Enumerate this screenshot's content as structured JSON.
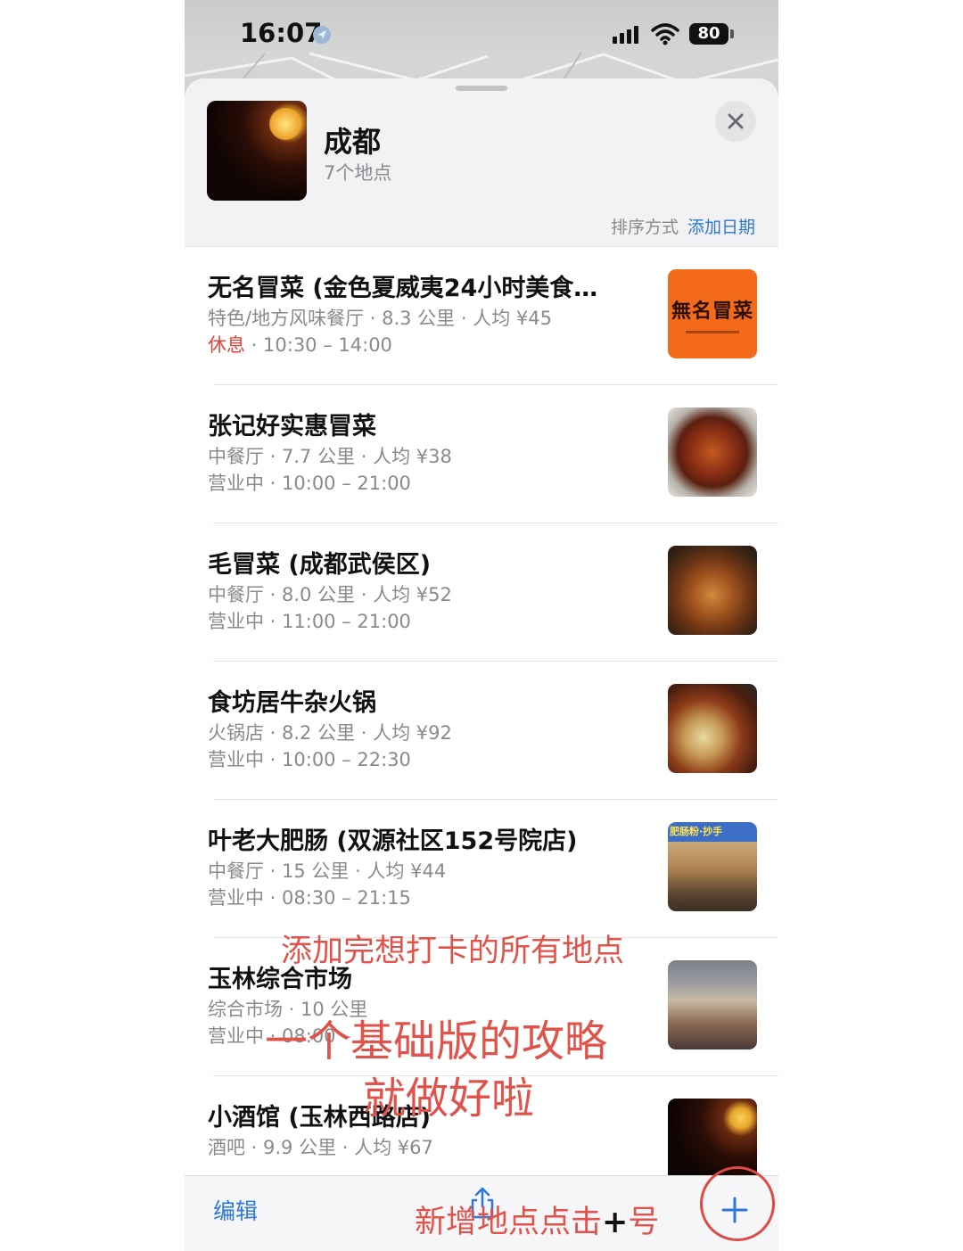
{
  "status_bar": {
    "time": "16:07",
    "battery": "80"
  },
  "header": {
    "title": "成都",
    "subtitle": "7个地点",
    "sort_label": "排序方式",
    "sort_value": "添加日期"
  },
  "places": [
    {
      "name": "无名冒菜 (金色夏威夷24小时美食…",
      "meta": "特色/地方风味餐厅 · 8.3 公里 · 人均 ¥45",
      "status": "休息",
      "hours": " · 10:30 – 14:00",
      "thumb_text": "無名冒菜"
    },
    {
      "name": "张记好实惠冒菜",
      "meta": "中餐厅 · 7.7 公里 · 人均 ¥38",
      "status": "营业中",
      "hours": " · 10:00 – 21:00"
    },
    {
      "name": "毛冒菜 (成都武侯区)",
      "meta": "中餐厅 · 8.0 公里 · 人均 ¥52",
      "status": "营业中",
      "hours": " · 11:00 – 21:00"
    },
    {
      "name": "食坊居牛杂火锅",
      "meta": "火锅店 · 8.2 公里 · 人均 ¥92",
      "status": "营业中",
      "hours": " · 10:00 – 22:30"
    },
    {
      "name": "叶老大肥肠 (双源社区152号院店)",
      "meta": "中餐厅 · 15 公里 · 人均 ¥44",
      "status": "营业中",
      "hours": " · 08:30 – 21:15",
      "thumb_text": "肥肠粉·抄手"
    },
    {
      "name": "玉林综合市场",
      "meta": "综合市场 · 10 公里",
      "status": "营业中",
      "hours": " · 08:00 – …"
    },
    {
      "name": "小酒馆 (玉林西路店)",
      "meta": "酒吧 · 9.9 公里 · 人均 ¥67",
      "status": "",
      "hours": ""
    }
  ],
  "annotations": {
    "line1": "添加完想打卡的所有地点",
    "line2": "一个基础版的攻略",
    "line3": "就做好啦",
    "line4_a": "新增地点点击",
    "line4_plus": "+",
    "line4_b": "号"
  },
  "toolbar": {
    "edit_label": "编辑"
  },
  "colors": {
    "accent": "#2b78d6",
    "closed": "#e0453a",
    "annotation": "#e0534a"
  }
}
